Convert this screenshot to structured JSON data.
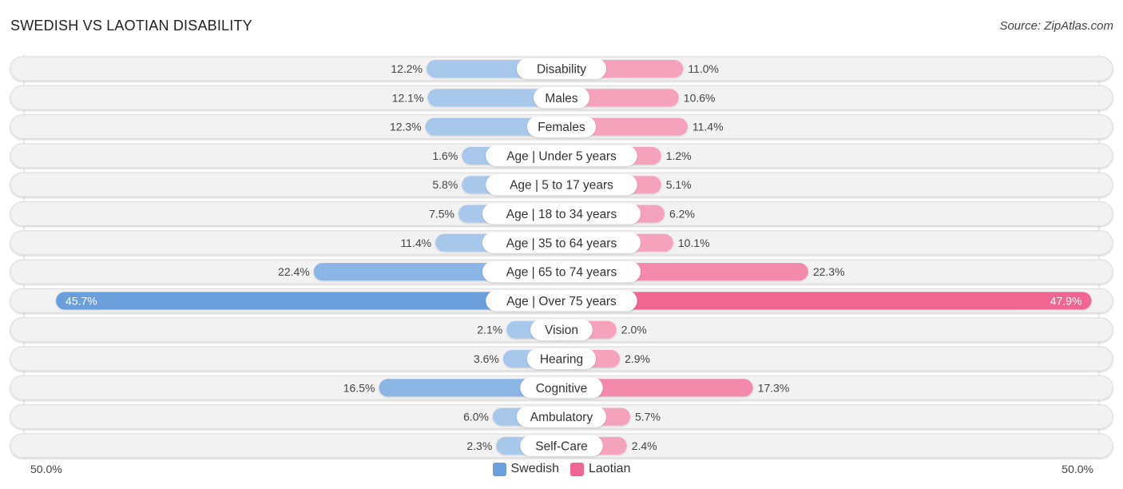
{
  "title": "SWEDISH VS LAOTIAN DISABILITY",
  "source": "Source: ZipAtlas.com",
  "colors": {
    "swedish": "#6a9fdb",
    "swedish_light": "#a8c8eb",
    "laotian": "#f06592",
    "laotian_light": "#f5a3bd",
    "track": "#f2f2f2"
  },
  "axis": {
    "left_label": "50.0%",
    "right_label": "50.0%"
  },
  "legend": [
    {
      "name": "Swedish",
      "color": "#6a9fdb"
    },
    {
      "name": "Laotian",
      "color": "#f06592"
    }
  ],
  "chart_data": {
    "type": "bar",
    "orientation": "horizontal-diverging",
    "title": "SWEDISH VS LAOTIAN DISABILITY",
    "xlabel": "",
    "ylabel": "",
    "xlim": [
      -50,
      50
    ],
    "axis_tick_labels": [
      "50.0%",
      "50.0%"
    ],
    "legend_position": "bottom-center",
    "categories": [
      "Disability",
      "Males",
      "Females",
      "Age | Under 5 years",
      "Age | 5 to 17 years",
      "Age | 18 to 34 years",
      "Age | 35 to 64 years",
      "Age | 65 to 74 years",
      "Age | Over 75 years",
      "Vision",
      "Hearing",
      "Cognitive",
      "Ambulatory",
      "Self-Care"
    ],
    "series": [
      {
        "name": "Swedish",
        "values": [
          12.2,
          12.1,
          12.3,
          1.6,
          5.8,
          7.5,
          11.4,
          22.4,
          45.7,
          2.1,
          3.6,
          16.5,
          6.0,
          2.3
        ],
        "labels": [
          "12.2%",
          "12.1%",
          "12.3%",
          "1.6%",
          "5.8%",
          "7.5%",
          "11.4%",
          "22.4%",
          "45.7%",
          "2.1%",
          "3.6%",
          "16.5%",
          "6.0%",
          "2.3%"
        ]
      },
      {
        "name": "Laotian",
        "values": [
          11.0,
          10.6,
          11.4,
          1.2,
          5.1,
          6.2,
          10.1,
          22.3,
          47.9,
          2.0,
          2.9,
          17.3,
          5.7,
          2.4
        ],
        "labels": [
          "11.0%",
          "10.6%",
          "11.4%",
          "1.2%",
          "5.1%",
          "6.2%",
          "10.1%",
          "22.3%",
          "47.9%",
          "2.0%",
          "2.9%",
          "17.3%",
          "5.7%",
          "2.4%"
        ]
      }
    ]
  }
}
